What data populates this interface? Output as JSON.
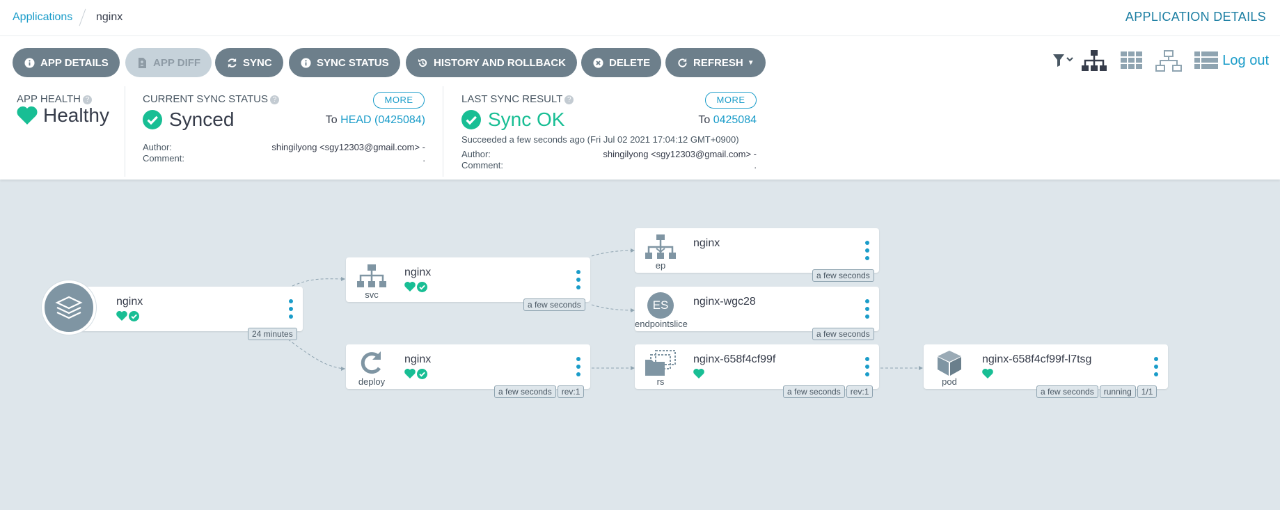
{
  "breadcrumb": {
    "root": "Applications",
    "current": "nginx"
  },
  "page_title": "APPLICATION DETAILS",
  "toolbar": {
    "app_details": "APP DETAILS",
    "app_diff": "APP DIFF",
    "sync": "SYNC",
    "sync_status": "SYNC STATUS",
    "history": "HISTORY AND ROLLBACK",
    "delete": "DELETE",
    "refresh": "REFRESH",
    "logout": "Log out"
  },
  "app_health": {
    "label": "APP HEALTH",
    "value": "Healthy"
  },
  "sync_status": {
    "label": "CURRENT SYNC STATUS",
    "value": "Synced",
    "more": "MORE",
    "to_prefix": "To",
    "revision": "HEAD (0425084)",
    "author_label": "Author:",
    "comment_label": "Comment:",
    "author": "shingilyong <sgy12303@gmail.com> -",
    "comment": "."
  },
  "last_sync": {
    "label": "LAST SYNC RESULT",
    "value": "Sync OK",
    "more": "MORE",
    "to_prefix": "To",
    "revision": "0425084",
    "succeeded": "Succeeded a few seconds ago (Fri Jul 02 2021 17:04:12 GMT+0900)",
    "author_label": "Author:",
    "comment_label": "Comment:",
    "author": "shingilyong <sgy12303@gmail.com> -",
    "comment": "."
  },
  "graph": {
    "app": {
      "name": "nginx",
      "tag": "24 minutes"
    },
    "nodes": {
      "svc": {
        "name": "nginx",
        "kind": "svc",
        "tags": [
          "a few seconds"
        ]
      },
      "deploy": {
        "name": "nginx",
        "kind": "deploy",
        "tags": [
          "a few seconds",
          "rev:1"
        ]
      },
      "ep": {
        "name": "nginx",
        "kind": "ep",
        "tags": [
          "a few seconds"
        ]
      },
      "eps": {
        "name": "nginx-wgc28",
        "kind": "endpointslice",
        "icon_text": "ES",
        "tags": [
          "a few seconds"
        ]
      },
      "rs": {
        "name": "nginx-658f4cf99f",
        "kind": "rs",
        "tags": [
          "a few seconds",
          "rev:1"
        ]
      },
      "pod": {
        "name": "nginx-658f4cf99f-l7tsg",
        "kind": "pod",
        "tags": [
          "a few seconds",
          "running",
          "1/1"
        ]
      }
    }
  },
  "colors": {
    "accent": "#1a9cc9",
    "healthy": "#18be94",
    "button": "#6d7f8b",
    "canvas": "#dee6eb"
  }
}
